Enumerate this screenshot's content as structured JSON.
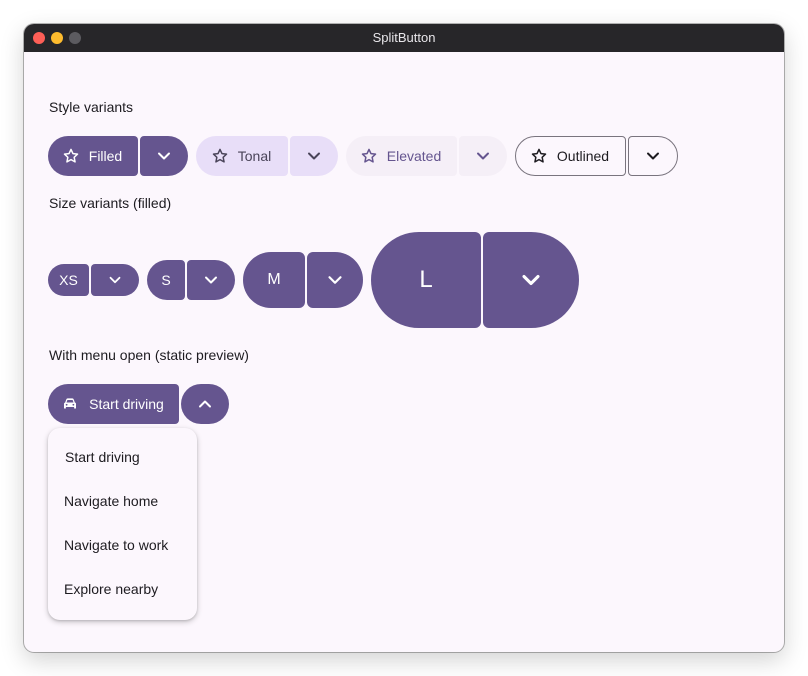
{
  "window": {
    "title": "SplitButton"
  },
  "sections": {
    "style": "Style variants",
    "size": "Size variants (filled)",
    "menu": "With menu open (static preview)"
  },
  "style_variants": {
    "filled": "Filled",
    "tonal": "Tonal",
    "elevated": "Elevated",
    "outlined": "Outlined"
  },
  "size_variants": {
    "xs": "XS",
    "s": "S",
    "m": "M",
    "l": "L"
  },
  "menu_button": {
    "label": "Start driving"
  },
  "menu_items": [
    "Start driving",
    "Navigate home",
    "Navigate to work",
    "Explore nearby"
  ],
  "icons": {
    "style_leading": "star-outline-icon",
    "trailing": "chevron-down-icon",
    "menu_leading": "car-icon",
    "menu_trailing": "chevron-up-icon"
  },
  "colors": {
    "primary": "#65558f",
    "on_primary": "#ffffff",
    "secondary_container": "#e8def8",
    "on_secondary_container": "#4a4459",
    "surface_container_low": "#f5eff7",
    "outline": "#79747e",
    "surface": "#fcf7fd",
    "on_surface": "#1d1b20"
  }
}
